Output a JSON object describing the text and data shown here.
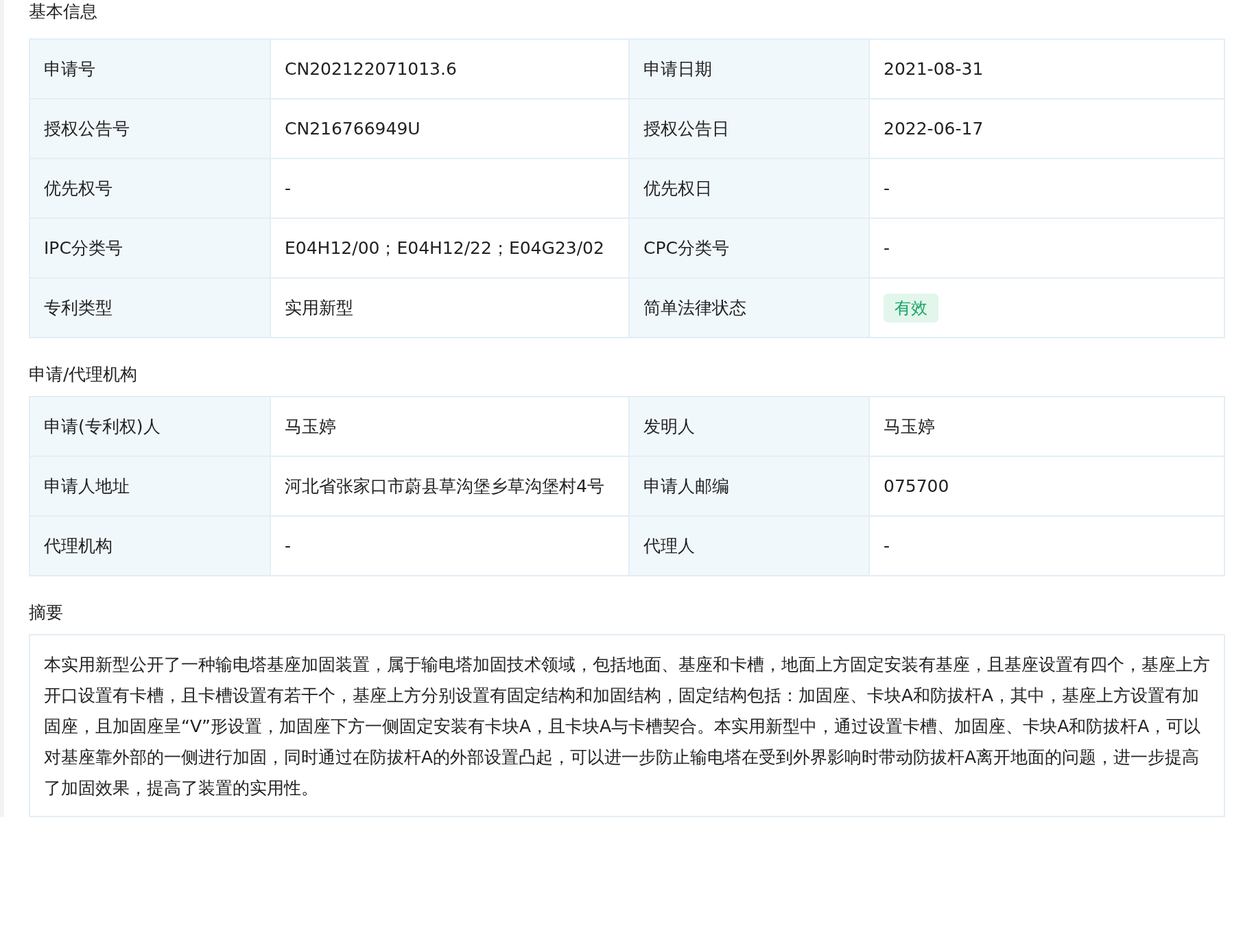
{
  "sections": [
    {
      "title": "基本信息",
      "rows": [
        [
          {
            "label": "申请号",
            "value": "CN202122071013.6",
            "kind": "text"
          },
          {
            "label": "申请日期",
            "value": "2021-08-31",
            "kind": "text"
          }
        ],
        [
          {
            "label": "授权公告号",
            "value": "CN216766949U",
            "kind": "text"
          },
          {
            "label": "授权公告日",
            "value": "2022-06-17",
            "kind": "text"
          }
        ],
        [
          {
            "label": "优先权号",
            "value": "-",
            "kind": "text"
          },
          {
            "label": "优先权日",
            "value": "-",
            "kind": "text"
          }
        ],
        [
          {
            "label": "IPC分类号",
            "value": "E04H12/00；E04H12/22；E04G23/02",
            "kind": "text"
          },
          {
            "label": "CPC分类号",
            "value": "-",
            "kind": "text"
          }
        ],
        [
          {
            "label": "专利类型",
            "value": "实用新型",
            "kind": "text"
          },
          {
            "label": "简单法律状态",
            "value": "有效",
            "kind": "tag"
          }
        ]
      ]
    },
    {
      "title": "申请/代理机构",
      "rows": [
        [
          {
            "label": "申请(专利权)人",
            "value": "马玉婷",
            "kind": "text"
          },
          {
            "label": "发明人",
            "value": "马玉婷",
            "kind": "text"
          }
        ],
        [
          {
            "label": "申请人地址",
            "value": "河北省张家口市蔚县草沟堡乡草沟堡村4号",
            "kind": "text"
          },
          {
            "label": "申请人邮编",
            "value": "075700",
            "kind": "text"
          }
        ],
        [
          {
            "label": "代理机构",
            "value": "-",
            "kind": "text"
          },
          {
            "label": "代理人",
            "value": "-",
            "kind": "text"
          }
        ]
      ]
    }
  ],
  "abstract": {
    "title": "摘要",
    "text": "本实用新型公开了一种输电塔基座加固装置，属于输电塔加固技术领域，包括地面、基座和卡槽，地面上方固定安装有基座，且基座设置有四个，基座上方开口设置有卡槽，且卡槽设置有若干个，基座上方分别设置有固定结构和加固结构，固定结构包括：加固座、卡块A和防拔杆A，其中，基座上方设置有加固座，且加固座呈“V”形设置，加固座下方一侧固定安装有卡块A，且卡块A与卡槽契合。本实用新型中，通过设置卡槽、加固座、卡块A和防拔杆A，可以对基座靠外部的一侧进行加固，同时通过在防拔杆A的外部设置凸起，可以进一步防止输电塔在受到外界影响时带动防拔杆A离开地面的问题，进一步提高了加固效果，提高了装置的实用性。"
  }
}
